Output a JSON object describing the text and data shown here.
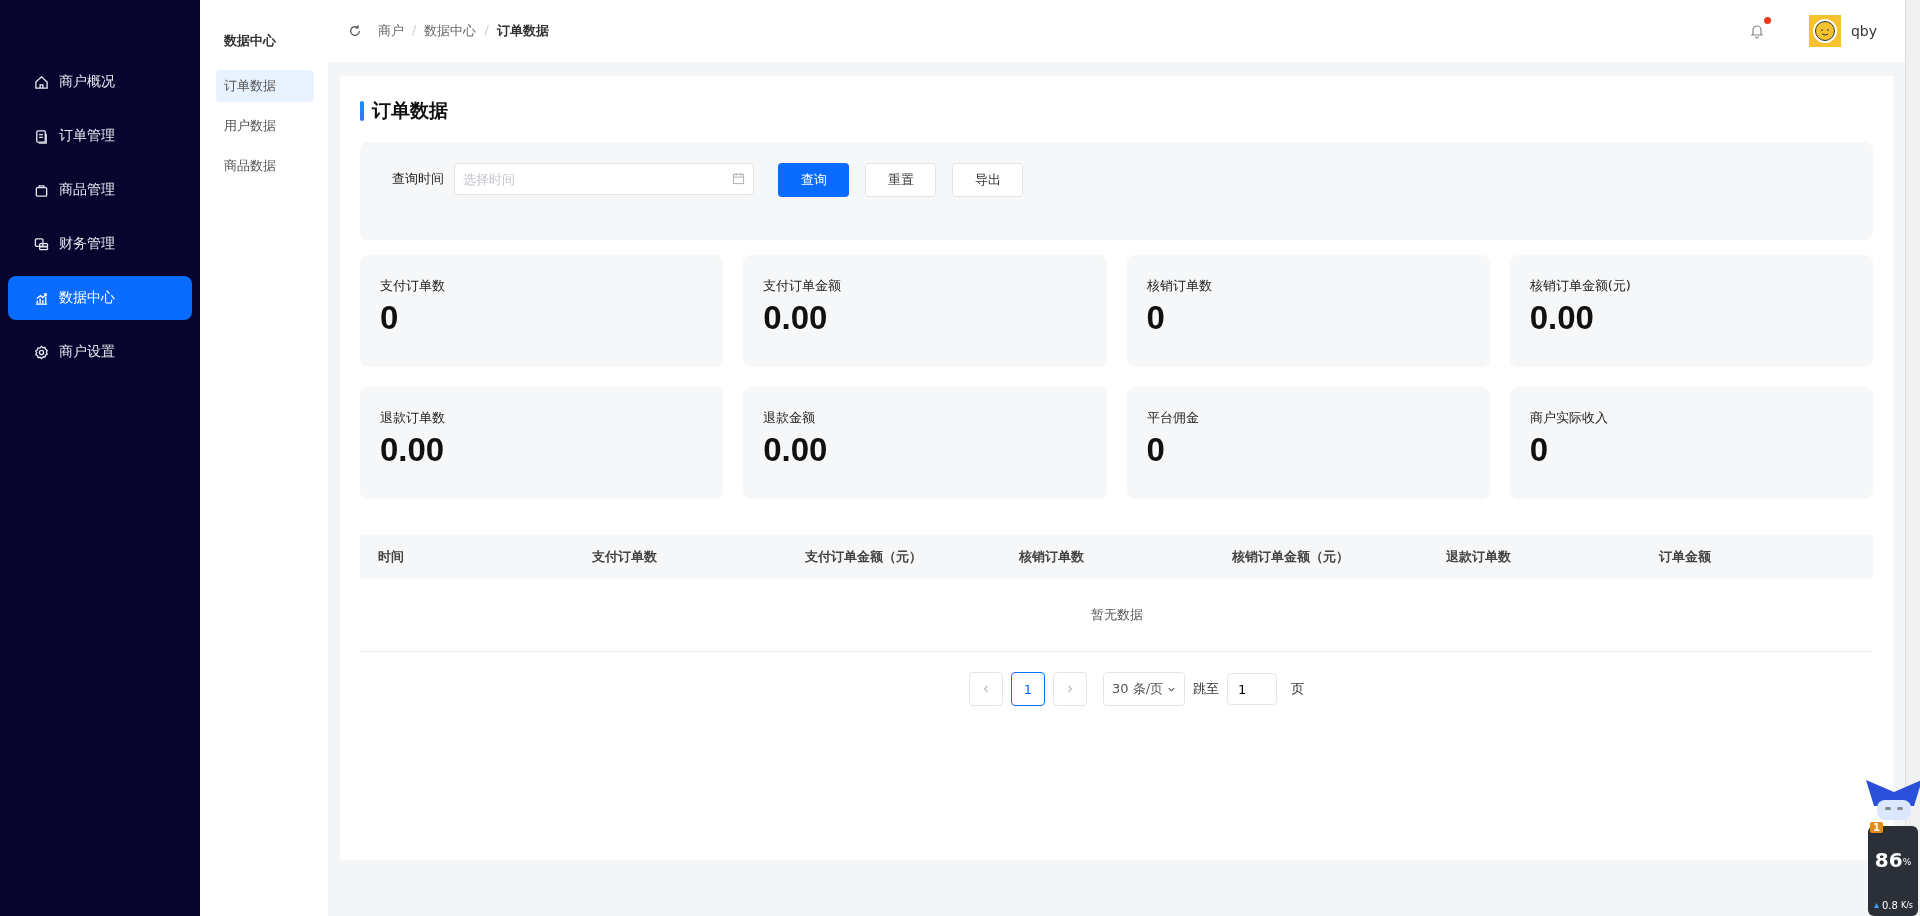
{
  "sidebar": {
    "items": [
      {
        "label": "商户概况",
        "selected": false
      },
      {
        "label": "订单管理",
        "selected": false
      },
      {
        "label": "商品管理",
        "selected": false
      },
      {
        "label": "财务管理",
        "selected": false
      },
      {
        "label": "数据中心",
        "selected": true
      },
      {
        "label": "商户设置",
        "selected": false
      }
    ]
  },
  "subnav": {
    "title": "数据中心",
    "items": [
      {
        "label": "订单数据",
        "selected": true
      },
      {
        "label": "用户数据",
        "selected": false
      },
      {
        "label": "商品数据",
        "selected": false
      }
    ]
  },
  "breadcrumb": [
    "商户",
    "数据中心",
    "订单数据"
  ],
  "breadcrumb_separator": "/",
  "header": {
    "notification_dot": true,
    "username": "qby"
  },
  "page_title": "订单数据",
  "filter": {
    "label": "查询时间",
    "placeholder": "选择时间",
    "buttons": [
      {
        "label": "查询",
        "kind": "primary"
      },
      {
        "label": "重置",
        "kind": "default"
      },
      {
        "label": "导出",
        "kind": "default"
      }
    ]
  },
  "stats": [
    {
      "label": "支付订单数",
      "value": "0"
    },
    {
      "label": "支付订单金额",
      "value": "0.00"
    },
    {
      "label": "核销订单数",
      "value": "0"
    },
    {
      "label": "核销订单金额(元)",
      "value": "0.00"
    },
    {
      "label": "退款订单数",
      "value": "0.00"
    },
    {
      "label": "退款金额",
      "value": "0.00"
    },
    {
      "label": "平台佣金",
      "value": "0"
    },
    {
      "label": "商户实际收入",
      "value": "0"
    }
  ],
  "table": {
    "columns": [
      "时间",
      "支付订单数",
      "支付订单金额（元）",
      "核销订单数",
      "核销订单金额（元）",
      "退款订单数",
      "订单金额"
    ],
    "empty_text": "暂无数据"
  },
  "pagination": {
    "pages": [
      {
        "label": "1",
        "selected": true
      }
    ],
    "page_size": "30 条/页",
    "jump_label": "跳至",
    "jump_value": "1",
    "page_suffix": "页"
  },
  "monitor_widget": {
    "badge": "1",
    "percent": "86",
    "percent_unit": "%",
    "speed": "0.8",
    "speed_unit": "K/s"
  }
}
